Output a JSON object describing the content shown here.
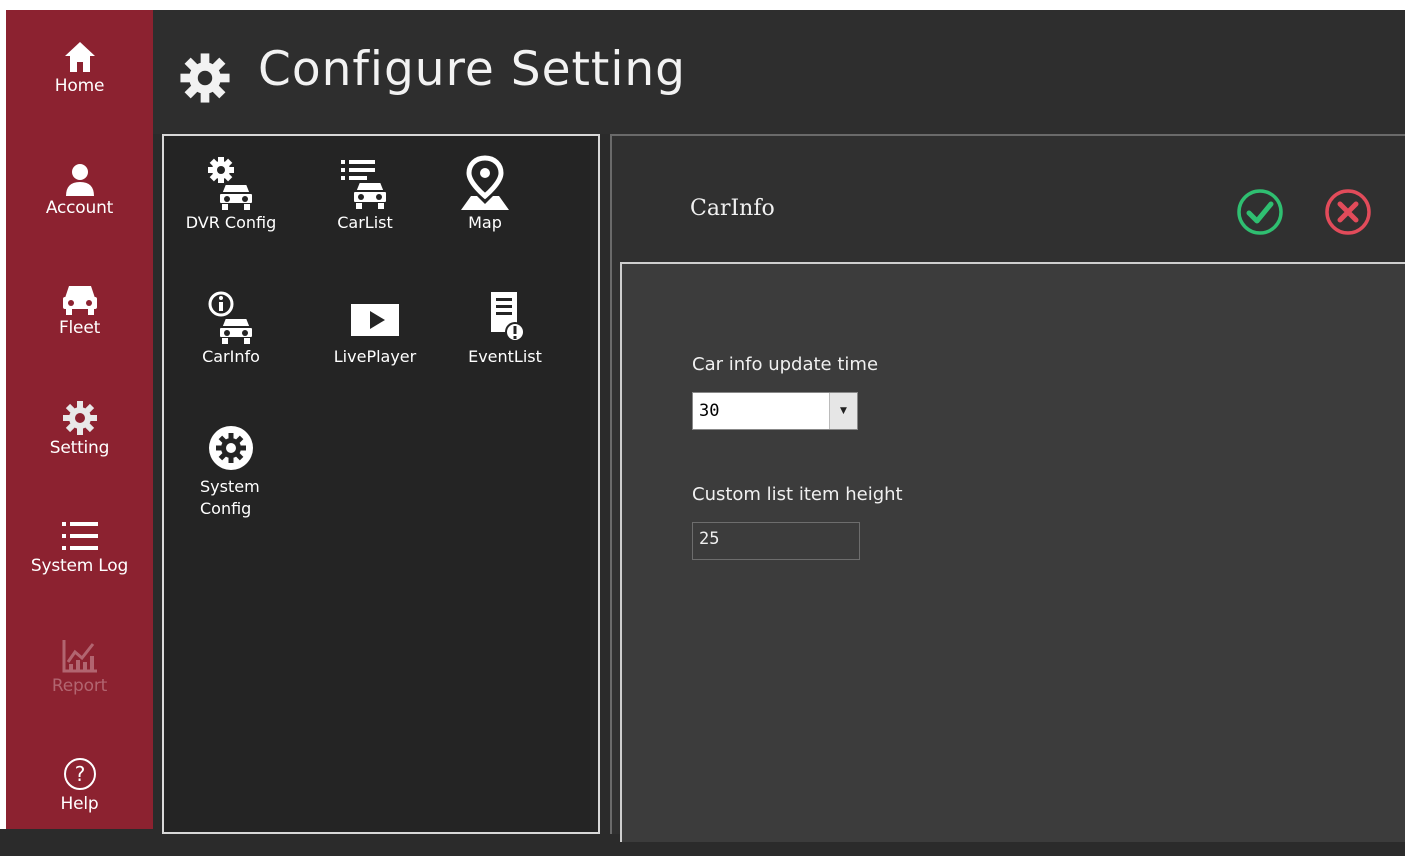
{
  "sidebar": {
    "items": [
      {
        "label": "Home",
        "icon": "home-icon"
      },
      {
        "label": "Account",
        "icon": "user-icon"
      },
      {
        "label": "Fleet",
        "icon": "car-icon"
      },
      {
        "label": "Setting",
        "icon": "gear-icon"
      },
      {
        "label": "System Log",
        "icon": "list-icon"
      },
      {
        "label": "Report",
        "icon": "chart-icon",
        "disabled": true
      },
      {
        "label": "Help",
        "icon": "help-icon"
      }
    ]
  },
  "header": {
    "title": "Configure Setting",
    "icon": "gear-icon"
  },
  "tiles": [
    {
      "label": "DVR Config",
      "icon": "dvr-config-icon"
    },
    {
      "label": "CarList",
      "icon": "carlist-icon"
    },
    {
      "label": "Map",
      "icon": "map-pin-icon"
    },
    {
      "label": "CarInfo",
      "icon": "carinfo-icon"
    },
    {
      "label": "LivePlayer",
      "icon": "play-icon"
    },
    {
      "label": "EventList",
      "icon": "event-list-icon"
    },
    {
      "label_line1": "System",
      "label_line2": "Config",
      "icon": "system-config-icon"
    }
  ],
  "panel": {
    "title": "CarInfo",
    "update_time_label": "Car info update time",
    "update_time_value": "30",
    "item_height_label": "Custom list item height",
    "item_height_value": "25"
  },
  "colors": {
    "sidebar": "#8c2230",
    "ok": "#2fbf71",
    "cancel": "#e24b5a"
  }
}
